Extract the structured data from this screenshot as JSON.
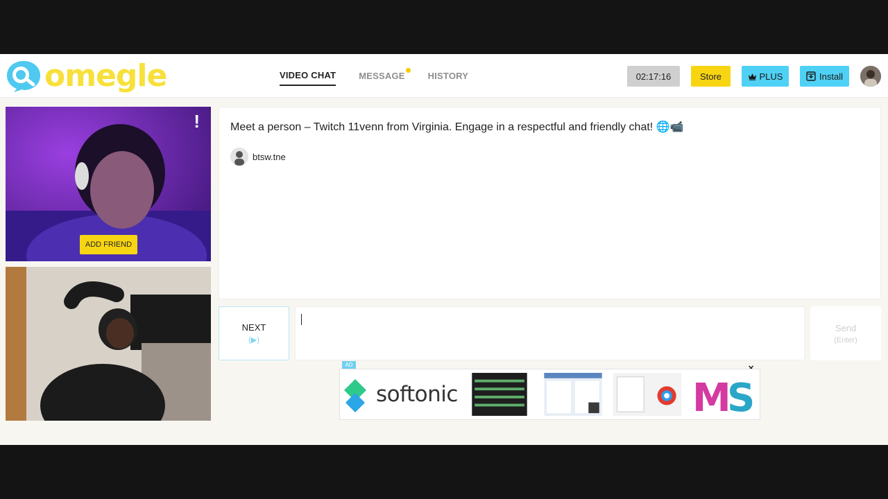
{
  "header": {
    "logo_text": "omegle",
    "tabs": [
      {
        "label": "VIDEO CHAT",
        "active": true
      },
      {
        "label": "MESSAGE",
        "active": false,
        "has_notification": true
      },
      {
        "label": "HISTORY",
        "active": false
      }
    ],
    "timer": "02:17:16",
    "store_label": "Store",
    "plus_label": "PLUS",
    "install_label": "Install"
  },
  "video": {
    "report_symbol": "!",
    "add_friend_label": "ADD FRIEND"
  },
  "chat": {
    "message": "Meet a person – Twitch 11venn from Virginia. Engage in a respectful and friendly chat! 🌐📹",
    "username": "btsw.tne"
  },
  "controls": {
    "next_label": "NEXT",
    "next_hint": "(▶)",
    "send_label": "Send",
    "send_hint": "(Enter)"
  },
  "ad": {
    "badge": "AD",
    "brand": "softonic",
    "close_symbol": "✕"
  },
  "colors": {
    "accent_yellow": "#f8d512",
    "accent_cyan": "#4fd1f5",
    "logo_blue": "#4fc9f0"
  }
}
